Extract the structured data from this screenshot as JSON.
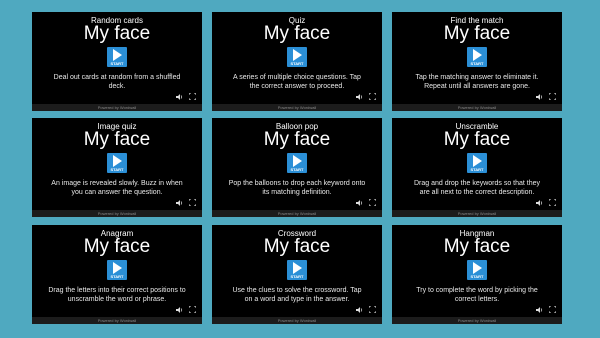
{
  "cards": [
    {
      "type": "Random cards",
      "title": "My face",
      "start": "START",
      "desc": "Deal out cards at random from a shuffled deck.",
      "footer": "Powered by Wordwall"
    },
    {
      "type": "Quiz",
      "title": "My face",
      "start": "START",
      "desc": "A series of multiple choice questions. Tap the correct answer to proceed.",
      "footer": "Powered by Wordwall"
    },
    {
      "type": "Find the match",
      "title": "My face",
      "start": "START",
      "desc": "Tap the matching answer to eliminate it. Repeat until all answers are gone.",
      "footer": "Powered by Wordwall"
    },
    {
      "type": "Image quiz",
      "title": "My face",
      "start": "START",
      "desc": "An image is revealed slowly. Buzz in when you can answer the question.",
      "footer": "Powered by Wordwall"
    },
    {
      "type": "Balloon pop",
      "title": "My face",
      "start": "START",
      "desc": "Pop the balloons to drop each keyword onto its matching definition.",
      "footer": "Powered by Wordwall"
    },
    {
      "type": "Unscramble",
      "title": "My face",
      "start": "START",
      "desc": "Drag and drop the keywords so that they are all next to the correct description.",
      "footer": "Powered by Wordwall"
    },
    {
      "type": "Anagram",
      "title": "My face",
      "start": "START",
      "desc": "Drag the letters into their correct positions to unscramble the word or phrase.",
      "footer": "Powered by Wordwall"
    },
    {
      "type": "Crossword",
      "title": "My face",
      "start": "START",
      "desc": "Use the clues to solve the crossword. Tap on a word and type in the answer.",
      "footer": "Powered by Wordwall"
    },
    {
      "type": "Hangman",
      "title": "My face",
      "start": "START",
      "desc": "Try to complete the word by picking the correct letters.",
      "footer": "Powered by Wordwall"
    }
  ]
}
